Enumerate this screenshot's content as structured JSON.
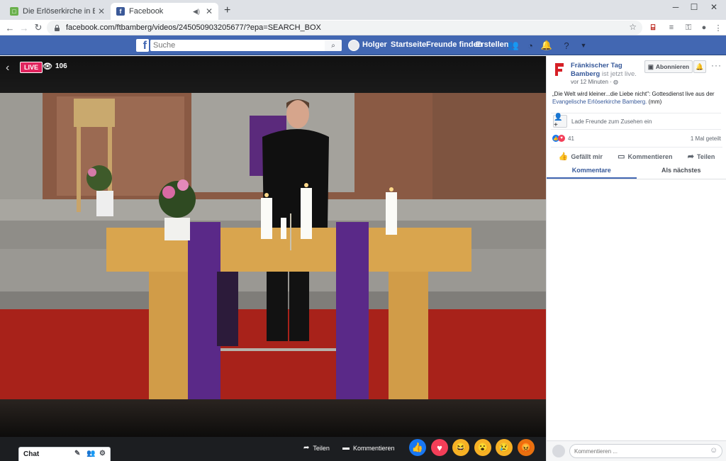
{
  "browser": {
    "tabs": [
      {
        "title": "Die Erlöserkirche in Bamberg ist",
        "active": false
      },
      {
        "title": "Facebook",
        "active": true
      }
    ],
    "url": "facebook.com/ftbamberg/videos/245050903205677/?epa=SEARCH_BOX",
    "window_controls": [
      "─",
      "☐",
      "✕"
    ]
  },
  "fb_header": {
    "search_placeholder": "Suche",
    "user_name": "Holger",
    "nav": [
      "Startseite",
      "Freunde finden",
      "Erstellen"
    ]
  },
  "video": {
    "live_label": "LIVE",
    "viewer_count": "106",
    "controls": {
      "share": "Teilen",
      "comment": "Kommentieren"
    },
    "reactions": [
      "like",
      "love",
      "haha",
      "wow",
      "sad",
      "angry"
    ]
  },
  "chat": {
    "label": "Chat"
  },
  "post": {
    "page_name": "Fränkischer Tag Bamberg",
    "live_suffix": "ist jetzt live.",
    "time": "vor 12 Minuten",
    "subscribe_label": "Abonnieren",
    "description": "„Die Welt wird kleiner...die Liebe nicht\": Gottesdienst live aus der",
    "description_link": "Evangelische Erlöserkirche Bamberg.",
    "description_suffix": "(mm)",
    "invite_text": "Lade Freunde zum Zusehen ein",
    "reaction_count": "41",
    "share_count": "1 Mal geteilt",
    "actions": [
      "Gefällt mir",
      "Kommentieren",
      "Teilen"
    ],
    "tabs": [
      "Kommentare",
      "Als nächstes"
    ],
    "comment_placeholder": "Kommentieren ..."
  },
  "colors": {
    "fb_blue": "#4267b2",
    "live_red": "#e0245e",
    "link": "#365899"
  }
}
